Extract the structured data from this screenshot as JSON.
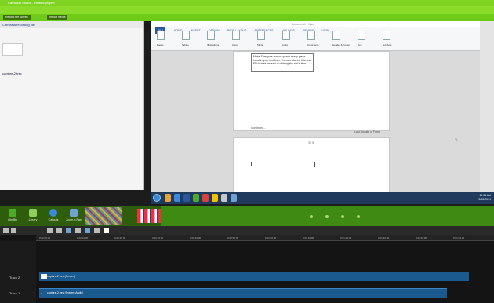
{
  "app": {
    "window_title": "Camtasia Studio - Untitled project",
    "menu": [
      "File",
      "Edit",
      "View",
      "Play",
      "Tools",
      "Help"
    ],
    "toolbar_buttons": [
      "Record the screen",
      "Import media"
    ]
  },
  "clip_bin": {
    "header": "Camtasia recording file",
    "clip_label": "capture-2.trec"
  },
  "word": {
    "tabs": [
      "FILE",
      "HOME",
      "INSERT",
      "DESIGN",
      "PAGE LAYOUT",
      "REFERENCES",
      "MAILINGS",
      "REVIEW",
      "VIEW"
    ],
    "title": "Document1 - Word",
    "ribbon_groups": [
      "Pages",
      "Tables",
      "Illustrations",
      "Apps",
      "Media",
      "Links",
      "Comments",
      "Header & Footer",
      "Text",
      "Symbols"
    ],
    "note_text": "Make Sure your cursor up and ready press hand in your text then. You can also hit this one FN to start instead of clicking the hot button.",
    "footer_left": "Continued...",
    "footer_right": "Last Update of Form",
    "page2_marker": "⊕ ⊕"
  },
  "taskbar": {
    "label": "Windows taskbar",
    "time": "11:34 AM",
    "date": "3/26/2014"
  },
  "tools": [
    {
      "label": "Clip Bin",
      "color": "#4ea82a"
    },
    {
      "label": "Library",
      "color": "#8fcf5c"
    },
    {
      "label": "Callouts",
      "color": "#3b8ad9"
    },
    {
      "label": "Zoom-n-Pan",
      "color": "#6fa3cf"
    }
  ],
  "timeline": {
    "ticks": [
      "0:00:00;00",
      "0:00:10;00",
      "0:00:20;00",
      "0:00:30;00",
      "0:00:40;00",
      "0:00:50;00",
      "0:01:00;00",
      "0:01:10;00",
      "0:01:20;00",
      "0:01:30;00",
      "0:01:40;00",
      "0:01:50;00"
    ],
    "tracks": [
      {
        "name": "Track 2",
        "clip": "capture-2.trec (Screen)"
      },
      {
        "name": "Track 1",
        "clip": "capture-2.trec (System Audio)"
      }
    ]
  },
  "colors": {
    "accent_green": "#7ed321",
    "clip_blue": "#1b5a8f",
    "word_blue": "#2b579a"
  }
}
